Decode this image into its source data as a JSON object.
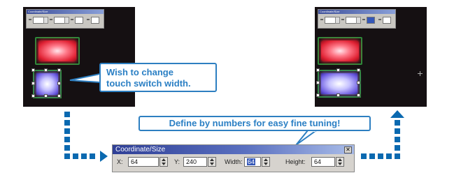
{
  "callouts": {
    "width_change": [
      "Wish to change",
      "touch switch width."
    ],
    "numbers": "Define by numbers for easy fine tuning!"
  },
  "panel": {
    "title": "Coordinate/Size",
    "close": "✕",
    "x_label": "X:",
    "x_value": "64",
    "y_label": "Y:",
    "y_value": "240",
    "width_label": "Width:",
    "width_value": "64",
    "height_label": "Height:",
    "height_value": "64"
  },
  "mini_window": {
    "title": "Coordinate/Size"
  },
  "colors": {
    "accent_blue": "#0a69b0",
    "callout_text": "#2a7fc4",
    "screen_bg": "#151012"
  },
  "icons": [
    "close-icon",
    "spin-up-icon",
    "spin-down-icon",
    "crosshair-icon",
    "arrow-right-icon",
    "arrow-up-icon"
  ]
}
